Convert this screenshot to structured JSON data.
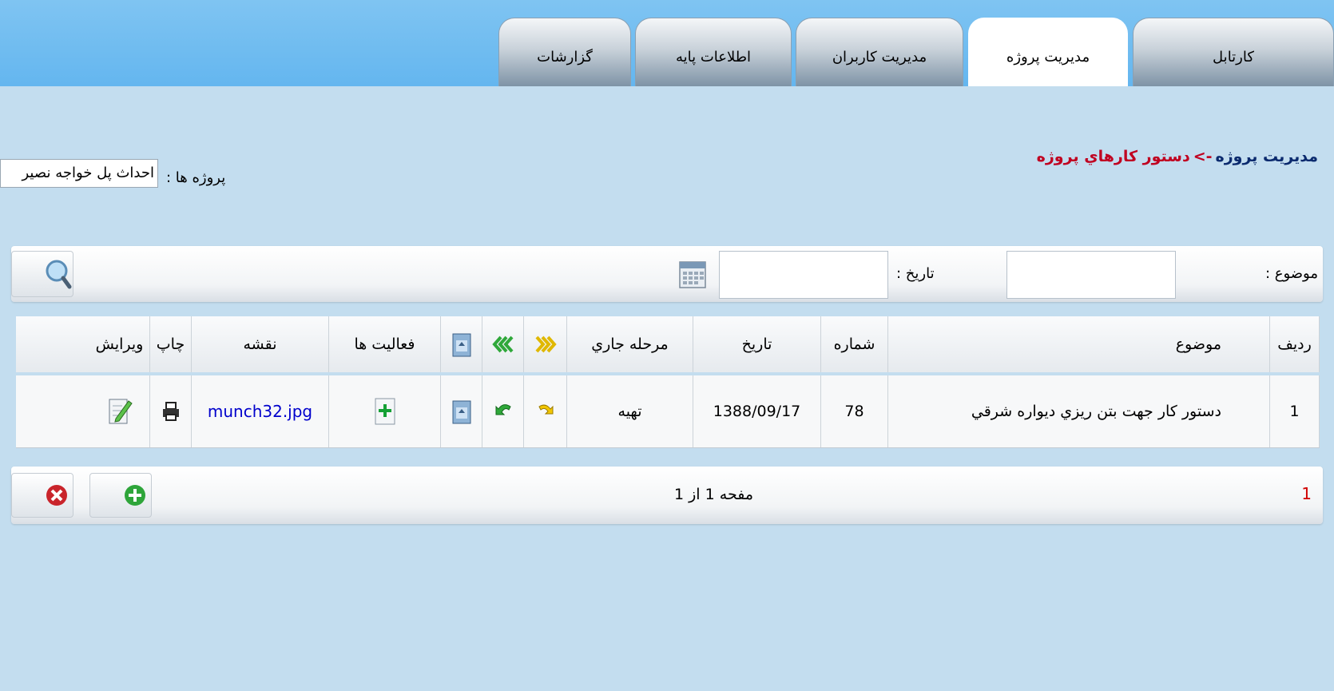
{
  "tabs": [
    {
      "label": "کارتابل",
      "active": false
    },
    {
      "label": "مدیریت پروژه",
      "active": true
    },
    {
      "label": "مدیریت کاربران",
      "active": false
    },
    {
      "label": "اطلاعات پایه",
      "active": false
    },
    {
      "label": "گزارشات",
      "active": false
    }
  ],
  "breadcrumb": {
    "parent": "مدیریت پروژه",
    "separator": "->",
    "current": "دستور کارهاي پروژه"
  },
  "project": {
    "label": "پروژه ها :",
    "selected": "احداث پل خواجه نصیر"
  },
  "search": {
    "subject_label": "موضوع :",
    "subject_value": "",
    "date_label": "تاریخ :",
    "date_value": "",
    "button_icon": "magnifier-icon",
    "calendar_icon": "calendar-icon"
  },
  "grid": {
    "headers": {
      "row_no": "ردیف",
      "subject": "موضوع",
      "number": "شماره",
      "date": "تاریخ",
      "stage": "مرحله جاري",
      "activities": "فعالیت ها",
      "map": "نقشه",
      "print": "چاپ",
      "edit": "ویرایش"
    },
    "rows": [
      {
        "row_no": "1",
        "subject": "دستور کار جهت بتن ریزي دیواره شرقي",
        "number": "78",
        "date": "1388/09/17",
        "stage": "تهیه",
        "map": "munch32.jpg"
      }
    ]
  },
  "pager": {
    "info": "مفحه 1 از 1",
    "current": "1",
    "add_icon": "add-icon",
    "delete_icon": "delete-icon"
  },
  "colors": {
    "header": "#64b6ef",
    "background": "#c3ddef",
    "breadcrumb_current": "#c00020",
    "link": "#0000cc"
  }
}
